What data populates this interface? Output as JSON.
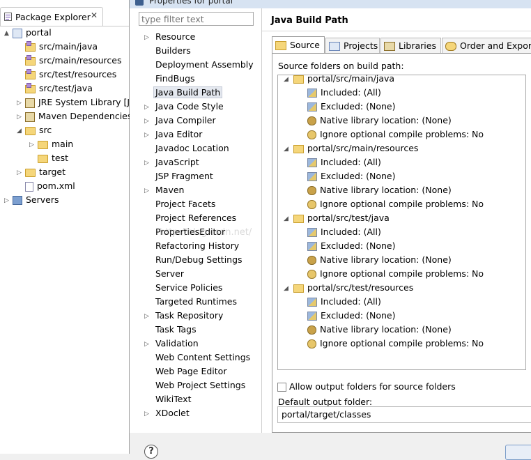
{
  "package_explorer": {
    "tab_label": "Package Explorer",
    "close_glyph": "✕",
    "tree": [
      {
        "label": "portal",
        "icon": "project-icon",
        "twisty": "▲"
      },
      {
        "label": "src/main/java",
        "icon": "source-folder-icon",
        "twisty": ""
      },
      {
        "label": "src/main/resources",
        "icon": "source-folder-icon",
        "twisty": ""
      },
      {
        "label": "src/test/resources",
        "icon": "source-folder-icon",
        "twisty": ""
      },
      {
        "label": "src/test/java",
        "icon": "source-folder-icon",
        "twisty": ""
      },
      {
        "label": "JRE System Library [J",
        "icon": "library-icon",
        "twisty": "▷"
      },
      {
        "label": "Maven Dependencies",
        "icon": "library-icon",
        "twisty": "▷"
      },
      {
        "label": "src",
        "icon": "folder-icon",
        "twisty": "◢"
      },
      {
        "label": "main",
        "icon": "folder-icon",
        "twisty": "▷"
      },
      {
        "label": "test",
        "icon": "folder-icon",
        "twisty": ""
      },
      {
        "label": "target",
        "icon": "folder-icon",
        "twisty": "▷"
      },
      {
        "label": "pom.xml",
        "icon": "xml-file-icon",
        "twisty": ""
      },
      {
        "label": "Servers",
        "icon": "servers-icon",
        "twisty": "▷"
      }
    ]
  },
  "dialog": {
    "title": "Properties for portal",
    "filter_placeholder": "type filter text",
    "nav_items": [
      {
        "label": "Resource",
        "expandable": true
      },
      {
        "label": "Builders",
        "expandable": false
      },
      {
        "label": "Deployment Assembly",
        "expandable": false
      },
      {
        "label": "FindBugs",
        "expandable": false
      },
      {
        "label": "Java Build Path",
        "expandable": false,
        "selected": true
      },
      {
        "label": "Java Code Style",
        "expandable": true
      },
      {
        "label": "Java Compiler",
        "expandable": true
      },
      {
        "label": "Java Editor",
        "expandable": true
      },
      {
        "label": "Javadoc Location",
        "expandable": false
      },
      {
        "label": "JavaScript",
        "expandable": true
      },
      {
        "label": "JSP Fragment",
        "expandable": false
      },
      {
        "label": "Maven",
        "expandable": true
      },
      {
        "label": "Project Facets",
        "expandable": false
      },
      {
        "label": "Project References",
        "expandable": false
      },
      {
        "label": "PropertiesEditor",
        "expandable": false
      },
      {
        "label": "Refactoring History",
        "expandable": false
      },
      {
        "label": "Run/Debug Settings",
        "expandable": false
      },
      {
        "label": "Server",
        "expandable": false
      },
      {
        "label": "Service Policies",
        "expandable": false
      },
      {
        "label": "Targeted Runtimes",
        "expandable": false
      },
      {
        "label": "Task Repository",
        "expandable": true
      },
      {
        "label": "Task Tags",
        "expandable": false
      },
      {
        "label": "Validation",
        "expandable": true
      },
      {
        "label": "Web Content Settings",
        "expandable": false
      },
      {
        "label": "Web Page Editor",
        "expandable": false
      },
      {
        "label": "Web Project Settings",
        "expandable": false
      },
      {
        "label": "WikiText",
        "expandable": false
      },
      {
        "label": "XDoclet",
        "expandable": true
      }
    ],
    "page_title": "Java Build Path",
    "tabs": [
      {
        "label": "Source",
        "icon": "source-tab-icon",
        "active": true
      },
      {
        "label": "Projects",
        "icon": "projects-tab-icon",
        "active": false
      },
      {
        "label": "Libraries",
        "icon": "libraries-tab-icon",
        "active": false
      },
      {
        "label": "Order and Export",
        "icon": "order-export-tab-icon",
        "active": false
      }
    ],
    "source_folders_label": "Source folders on build path:",
    "source_folders": [
      {
        "path": "portal/src/main/java",
        "children": [
          "Included: (All)",
          "Excluded: (None)",
          "Native library location: (None)",
          "Ignore optional compile problems: No"
        ]
      },
      {
        "path": "portal/src/main/resources",
        "children": [
          "Included: (All)",
          "Excluded: (None)",
          "Native library location: (None)",
          "Ignore optional compile problems: No"
        ]
      },
      {
        "path": "portal/src/test/java",
        "children": [
          "Included: (All)",
          "Excluded: (None)",
          "Native library location: (None)",
          "Ignore optional compile problems: No"
        ]
      },
      {
        "path": "portal/src/test/resources",
        "children": [
          "Included: (All)",
          "Excluded: (None)",
          "Native library location: (None)",
          "Ignore optional compile problems: No"
        ]
      }
    ],
    "allow_output_label": "Allow output folders for source folders",
    "default_output_label": "Default output folder:",
    "default_output_value": "portal/target/classes",
    "help_glyph": "?"
  },
  "watermark": "http://blog.csdn.net/"
}
